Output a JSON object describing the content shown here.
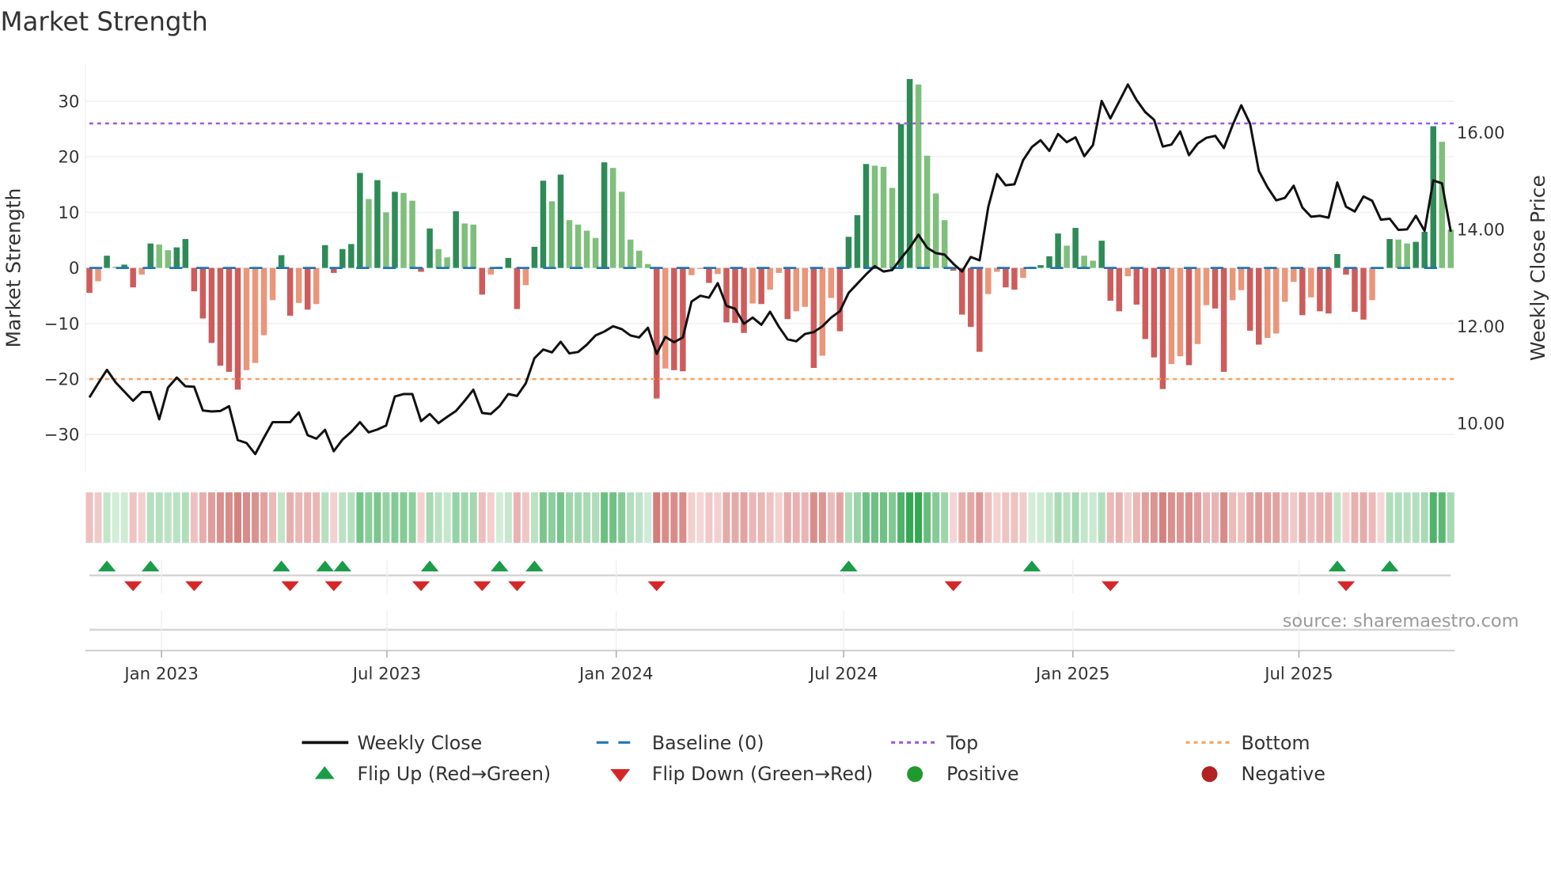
{
  "chart_data": {
    "type": "bar",
    "title": "Market Strength",
    "ylabel": "Market Strength",
    "y2label": "Weekly Close Price",
    "ylim": [
      -34,
      36
    ],
    "y2lim": [
      9.0,
      17.6
    ],
    "yticks": [
      30,
      20,
      10,
      0,
      -10,
      -20,
      -30
    ],
    "ytick_labels": [
      "30",
      "20",
      "10",
      "0",
      "−10",
      "−20",
      "−30"
    ],
    "y2ticks": [
      16,
      14,
      12,
      10
    ],
    "y2tick_labels": [
      "16.00",
      "14.00",
      "12.00",
      "10.00"
    ],
    "xticks": [
      {
        "label": "Jan 2023",
        "week": 8.26
      },
      {
        "label": "Jul 2023",
        "week": 34.09
      },
      {
        "label": "Jan 2024",
        "week": 60.37
      },
      {
        "label": "Jul 2024",
        "week": 86.43
      },
      {
        "label": "Jan 2025",
        "week": 112.7
      },
      {
        "label": "Jul 2025",
        "week": 138.6
      }
    ],
    "top_level": 26,
    "bottom_level": -20,
    "baseline": 0,
    "grid": true,
    "legend_position": "bottom",
    "strength": [
      -4.5,
      -2.4,
      2.2,
      0.2,
      0.6,
      -3.5,
      -1.2,
      4.4,
      4.2,
      3.2,
      3.7,
      5.2,
      -4.2,
      -9.1,
      -13.5,
      -17.6,
      -18.7,
      -21.9,
      -18.4,
      -17.1,
      -12.1,
      -5.8,
      2.3,
      -8.6,
      -6.3,
      -7.5,
      -6.5,
      4.1,
      -0.9,
      3.4,
      4.3,
      17.1,
      12.4,
      15.8,
      10.0,
      13.7,
      13.5,
      12.1,
      -0.7,
      7.1,
      3.4,
      1.9,
      10.2,
      8.0,
      7.8,
      -4.8,
      -1.2,
      0.2,
      1.8,
      -7.4,
      -3.1,
      3.8,
      15.7,
      12.0,
      16.8,
      8.6,
      7.8,
      6.7,
      5.4,
      19.0,
      18.0,
      13.7,
      5.1,
      3.1,
      0.7,
      -23.5,
      -18.1,
      -18.4,
      -18.6,
      -1.3,
      -0.2,
      -2.7,
      -1.1,
      -9.8,
      -9.9,
      -11.7,
      -6.4,
      -6.5,
      -3.9,
      -0.9,
      -9.2,
      -7.8,
      -7.0,
      -18.0,
      -15.8,
      -5.4,
      -11.4,
      5.6,
      9.5,
      18.7,
      18.4,
      18.2,
      14.4,
      25.9,
      34.0,
      33.0,
      20.2,
      13.4,
      8.6,
      -0.5,
      -8.4,
      -10.6,
      -15.1,
      -4.7,
      -0.7,
      -3.5,
      -3.9,
      -1.8,
      0.2,
      0.5,
      2.1,
      6.2,
      4.0,
      7.2,
      2.2,
      1.3,
      4.9,
      -5.9,
      -7.8,
      -1.5,
      -6.6,
      -12.8,
      -16.1,
      -21.8,
      -17.3,
      -15.9,
      -17.5,
      -13.7,
      -6.7,
      -7.3,
      -18.7,
      -5.8,
      -4.0,
      -11.3,
      -13.8,
      -12.6,
      -11.8,
      -6.1,
      -2.5,
      -8.5,
      -5.3,
      -7.8,
      -8.2,
      2.5,
      -1.2,
      -7.9,
      -9.3,
      -5.8,
      -0.2,
      5.2,
      5.1,
      4.4,
      4.7,
      6.5,
      25.5,
      22.7,
      6.9
    ],
    "weekly_close": [
      10.51,
      10.8,
      11.08,
      10.82,
      10.63,
      10.44,
      10.62,
      10.62,
      10.06,
      10.71,
      10.92,
      10.74,
      10.73,
      10.24,
      10.22,
      10.23,
      10.33,
      9.63,
      9.57,
      9.34,
      9.68,
      10.0,
      10.0,
      10.0,
      10.2,
      9.73,
      9.66,
      9.84,
      9.4,
      9.64,
      9.8,
      10.0,
      9.79,
      9.85,
      9.93,
      10.53,
      10.58,
      10.58,
      10.02,
      10.17,
      9.98,
      10.11,
      10.23,
      10.44,
      10.67,
      10.19,
      10.17,
      10.33,
      10.58,
      10.54,
      10.8,
      11.32,
      11.5,
      11.44,
      11.66,
      11.42,
      11.45,
      11.6,
      11.79,
      11.87,
      11.98,
      11.92,
      11.79,
      11.75,
      11.95,
      11.41,
      11.76,
      11.65,
      11.75,
      12.49,
      12.61,
      12.57,
      12.87,
      12.4,
      12.34,
      12.03,
      12.16,
      12.01,
      12.28,
      11.97,
      11.71,
      11.67,
      11.82,
      11.86,
      11.98,
      12.16,
      12.29,
      12.67,
      12.86,
      13.05,
      13.22,
      13.11,
      13.14,
      13.38,
      13.6,
      13.87,
      13.6,
      13.49,
      13.46,
      13.27,
      13.11,
      13.41,
      13.34,
      14.44,
      15.12,
      14.89,
      14.91,
      15.41,
      15.68,
      15.82,
      15.6,
      15.95,
      15.78,
      15.88,
      15.49,
      15.72,
      16.63,
      16.27,
      16.62,
      16.97,
      16.65,
      16.4,
      16.24,
      15.69,
      15.73,
      16.0,
      15.51,
      15.75,
      15.87,
      15.91,
      15.66,
      16.13,
      16.54,
      16.16,
      15.19,
      14.85,
      14.58,
      14.63,
      14.88,
      14.43,
      14.24,
      14.26,
      14.22,
      14.95,
      14.45,
      14.35,
      14.66,
      14.57,
      14.18,
      14.2,
      13.97,
      13.98,
      14.26,
      13.95,
      14.99,
      14.93,
      13.93
    ],
    "legend": [
      {
        "label": "Weekly Close",
        "symbol": "line"
      },
      {
        "label": "Baseline (0)",
        "symbol": "dashed-line"
      },
      {
        "label": "Top",
        "symbol": "dotted-line"
      },
      {
        "label": "Bottom",
        "symbol": "dotted-line"
      },
      {
        "label": "Flip Up (Red→Green)",
        "symbol": "triangle-up"
      },
      {
        "label": "Flip Down (Green→Red)",
        "symbol": "triangle-down"
      },
      {
        "label": "Positive",
        "symbol": "circle"
      },
      {
        "label": "Negative",
        "symbol": "circle"
      }
    ],
    "source": "source: sharemaestro.com"
  },
  "colors": {
    "pos_rising": "#2e8b57",
    "pos_falling": "#7fbf7b",
    "neg_falling": "#cd5c5c",
    "neg_rising": "#e9967a",
    "close": "#111111",
    "baseline": "#1f77b4",
    "top": "#9b59e0",
    "bottom": "#f4a261",
    "flip_up": "#1a9c48",
    "flip_down": "#d62728",
    "positive": "#1e9a2e",
    "negative": "#b22222"
  }
}
